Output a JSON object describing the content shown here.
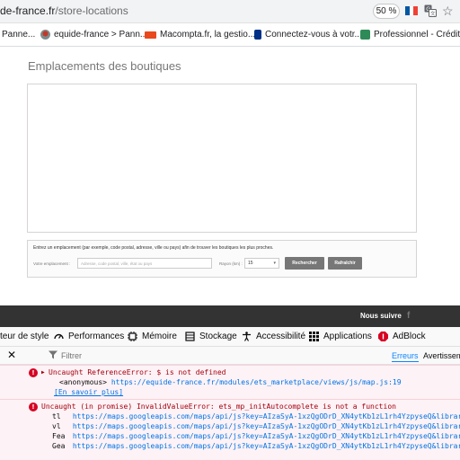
{
  "browser": {
    "url_domain": "de-france.fr",
    "url_path": "/store-locations",
    "zoom": "50 %",
    "colors": {
      "flag_blue": "#0055a4",
      "flag_white": "#ffffff",
      "flag_red": "#ef4135"
    }
  },
  "bookmarks": [
    {
      "label": "Panne...",
      "icon": "bookmark-favicon"
    },
    {
      "label": "equide-france > Pann...",
      "icon": "equide-favicon"
    },
    {
      "label": "Macompta.fr, la gestio...",
      "icon": "macompta-favicon"
    },
    {
      "label": "Connectez-vous à votr...",
      "icon": "paypal-favicon"
    },
    {
      "label": "Professionnel - Crédit ...",
      "icon": "credit-favicon"
    }
  ],
  "page": {
    "title": "Emplacements des boutiques",
    "search": {
      "instruction": "Entrez un emplacement (par exemple, code postal, adresse, ville ou pays) afin de trouver les boutiques les plus proches.",
      "location_label": "Votre emplacement :",
      "location_placeholder": "Adresse, code postal, ville, état ou pays",
      "radius_label": "Rayon (km) :",
      "radius_value": "15",
      "search_button": "Rechercher",
      "reset_button": "Rafraîchir"
    }
  },
  "footer": {
    "follow": "Nous suivre",
    "facebook_glyph": "f"
  },
  "devtools": {
    "tabs": [
      {
        "label": "teur de style",
        "icon": "style-editor-icon"
      },
      {
        "label": "Performances",
        "icon": "performance-icon"
      },
      {
        "label": "Mémoire",
        "icon": "memory-icon"
      },
      {
        "label": "Stockage",
        "icon": "storage-icon"
      },
      {
        "label": "Accessibilité",
        "icon": "accessibility-icon"
      },
      {
        "label": "Applications",
        "icon": "applications-icon"
      },
      {
        "label": "AdBlock",
        "icon": "adblock-icon"
      }
    ],
    "filter_placeholder": "Filtrer",
    "levels": {
      "errors": "Erreurs",
      "warnings": "Avertisseme"
    },
    "messages": [
      {
        "text": "Uncaught ReferenceError: $ is not defined",
        "stack": [
          {
            "fn": "<anonymous>",
            "url": "https://equide-france.fr/modules/ets_marketplace/views/js/map.js:19"
          }
        ],
        "learn_more": "[En savoir plus]"
      },
      {
        "text": "Uncaught (in promise) InvalidValueError: ets_mp_initAutocomplete is not a function",
        "stack": [
          {
            "fn": "tl",
            "url": "https://maps.googleapis.com/maps/api/js?key=AIzaSyA-1xzQgODrD_XN4ytKb1zL1rh4YzpyseQ&libraries=pla"
          },
          {
            "fn": "vl",
            "url": "https://maps.googleapis.com/maps/api/js?key=AIzaSyA-1xzQgODrD_XN4ytKb1zL1rh4YzpyseQ&libraries=pla"
          },
          {
            "fn": "Fea",
            "url": "https://maps.googleapis.com/maps/api/js?key=AIzaSyA-1xzQgODrD_XN4ytKb1zL1rh4YzpyseQ&libraries=pla"
          },
          {
            "fn": "Gea",
            "url": "https://maps.googleapis.com/maps/api/js?key=AIzaSyA-1xzQgODrD_XN4ytKb1zL1rh4YzpyseQ&libraries=pla"
          }
        ]
      }
    ]
  }
}
